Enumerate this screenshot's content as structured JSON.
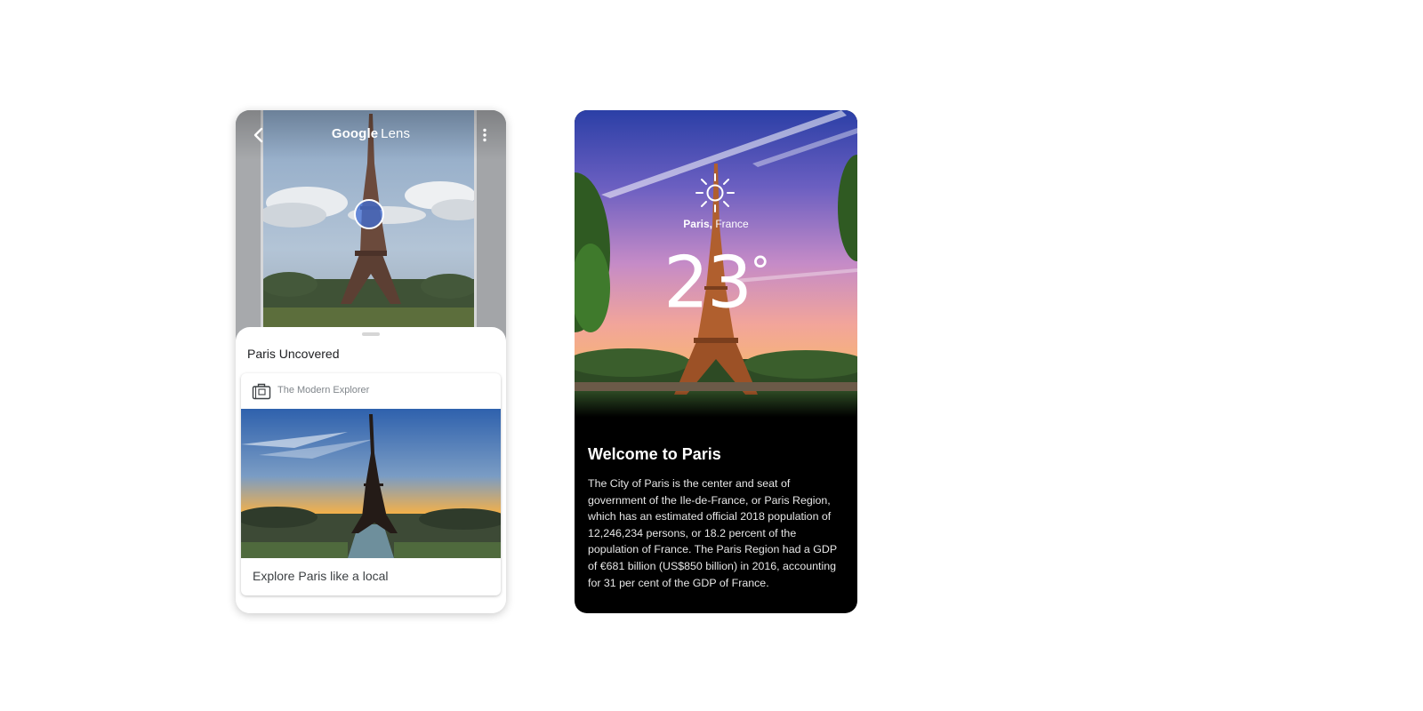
{
  "lens": {
    "app_title_brand": "Google",
    "app_title_product": "Lens",
    "back_icon": "chevron-left-icon",
    "more_icon": "more-vert-icon",
    "sheet_title": "Paris Uncovered",
    "result": {
      "source_icon": "suitcase-icon",
      "source_name": "The Modern Explorer",
      "caption": "Explore Paris like a local"
    }
  },
  "weather": {
    "icon": "sun-icon",
    "city": "Paris,",
    "country": "France",
    "temperature": "23",
    "degree_symbol": "°",
    "title": "Welcome to Paris",
    "body": "The City of Paris is the center and seat of government of the Ile-de-France, or Paris Region, which has an estimated official 2018 population of 12,246,234 persons, or 18.2 percent of the population of France. The Paris Region had a GDP of €681 billion (US$850 billion) in 2016, accounting for 31 per cent of the GDP of France."
  },
  "colors": {
    "lens_focus": "#426ed2",
    "sheet_bg": "#ffffff",
    "weather_panel_bg": "#000000"
  }
}
